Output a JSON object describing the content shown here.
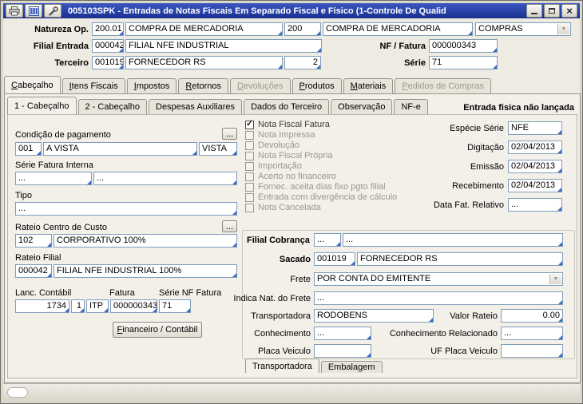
{
  "colors": {
    "titlebar_blue": "#2742a8",
    "field_border": "#7f9db9",
    "field_corner_accent": "#3a6bc8",
    "window_bg": "#edebe2",
    "panel_bg": "#f2f0e8"
  },
  "ui": {
    "browse_label": "..."
  },
  "window": {
    "title": "005103SPK - Entradas de Notas Fiscais Em Separado Fiscal e Físico (1-Controle De Qualid",
    "toolbar_icons": [
      "printer-icon",
      "table-icon",
      "wrench-icon"
    ]
  },
  "header": {
    "natureza_label": "Natureza Op.",
    "natureza_code": "200.01",
    "natureza_desc": "COMPRA DE MERCADORIA",
    "natureza_code2": "200",
    "natureza_desc2": "COMPRA DE MERCADORIA",
    "categoria": "COMPRAS",
    "filial_label": "Filial Entrada",
    "filial_code": "000042",
    "filial_desc": "FILIAL NFE INDUSTRIAL",
    "nf_label": "NF / Fatura",
    "nf_value": "000000343",
    "terceiro_label": "Terceiro",
    "terceiro_code": "001019",
    "terceiro_desc": "FORNECEDOR RS",
    "terceiro_loja": "2",
    "serie_label": "Série",
    "serie_value": "71"
  },
  "main_tabs": [
    {
      "label": "Cabeçalho",
      "active": true
    },
    {
      "label": "Itens Fiscais"
    },
    {
      "label": "Impostos"
    },
    {
      "label": "Retornos"
    },
    {
      "label": "Devoluções",
      "disabled": true
    },
    {
      "label": "Produtos"
    },
    {
      "label": "Materiais"
    },
    {
      "label": "Pedidos de Compras",
      "disabled": true
    }
  ],
  "sub_tabs": [
    {
      "label": "1 - Cabeçalho",
      "active": true
    },
    {
      "label": "2 - Cabeçalho"
    },
    {
      "label": "Despesas Auxiliares"
    },
    {
      "label": "Dados do Terceiro"
    },
    {
      "label": "Observação"
    },
    {
      "label": "NF-e"
    }
  ],
  "status_flag": "Entrada fisica não lançada",
  "left": {
    "cond_pag_label": "Condição de pagamento",
    "cond_code": "001",
    "cond_desc": "A VISTA",
    "cond_tipo": "VISTA",
    "serie_fatura_label": "Série Fatura Interna",
    "serie_fatura_1": "...",
    "serie_fatura_2": "...",
    "tipo_label": "Tipo",
    "tipo_value": "...",
    "rateio_cc_label": "Rateio Centro de Custo",
    "rateio_cc_code": "102",
    "rateio_cc_desc": "CORPORATIVO 100%",
    "rateio_filial_label": "Rateio Filial",
    "rateio_filial_code": "000042",
    "rateio_filial_desc": "FILIAL NFE INDUSTRIAL 100%",
    "lanc_label": "Lanc. Contábil",
    "fatura_label": "Fatura",
    "serie_nf_label": "Série NF Fatura",
    "lanc_value": "1734",
    "lanc_seq": "1",
    "fatura_pref": "ITP",
    "fatura_num": "000000343",
    "fatura_serie": "71",
    "financeiro_btn": "Financeiro / Contábil"
  },
  "checkboxes": [
    {
      "label": "Nota Fiscal Fatura",
      "checked": true
    },
    {
      "label": "Nota Impressa"
    },
    {
      "label": "Devolução"
    },
    {
      "label": "Nota Fiscal Própria"
    },
    {
      "label": "Importação"
    },
    {
      "label": "Acerto no financeiro"
    },
    {
      "label": "Fornec. aceita dias fixo pgto filial"
    },
    {
      "label": "Entrada com divergência de cálculo"
    },
    {
      "label": "Nota Cancelada"
    }
  ],
  "dates": {
    "especie_label": "Espécie Série",
    "especie_value": "NFE",
    "digitacao_label": "Digitação",
    "digitacao_value": "02/04/2013",
    "emissao_label": "Emissão",
    "emissao_value": "02/04/2013",
    "recebimento_label": "Recebimento",
    "recebimento_value": "02/04/2013",
    "data_fat_label": "Data Fat. Relativo",
    "data_fat_value": "..."
  },
  "cobranca": {
    "filial_cobranca_label": "Filial Cobrança",
    "filial_cobranca_1": "...",
    "filial_cobranca_2": "...",
    "sacado_label": "Sacado",
    "sacado_code": "001019",
    "sacado_desc": "FORNECEDOR RS",
    "frete_label": "Frete",
    "frete_value": "POR CONTA DO EMITENTE",
    "indica_nat_label": "Indica Nat. do Frete",
    "indica_nat_value": "...",
    "transportadora_label": "Transportadora",
    "transportadora_value": "RODOBENS",
    "valor_rateio_label": "Valor Rateio",
    "valor_rateio_value": "0.00",
    "conhecimento_label": "Conhecimento",
    "conhecimento_value": "...",
    "conhecimento_rel_label": "Conhecimento Relacionado",
    "conhecimento_rel_value": "...",
    "placa_label": "Placa Veiculo",
    "placa_value": "",
    "uf_placa_label": "UF Placa Veiculo",
    "uf_placa_value": ""
  },
  "bottom_tabs": [
    {
      "label": "Transportadora",
      "active": true
    },
    {
      "label": "Embalagem"
    }
  ]
}
